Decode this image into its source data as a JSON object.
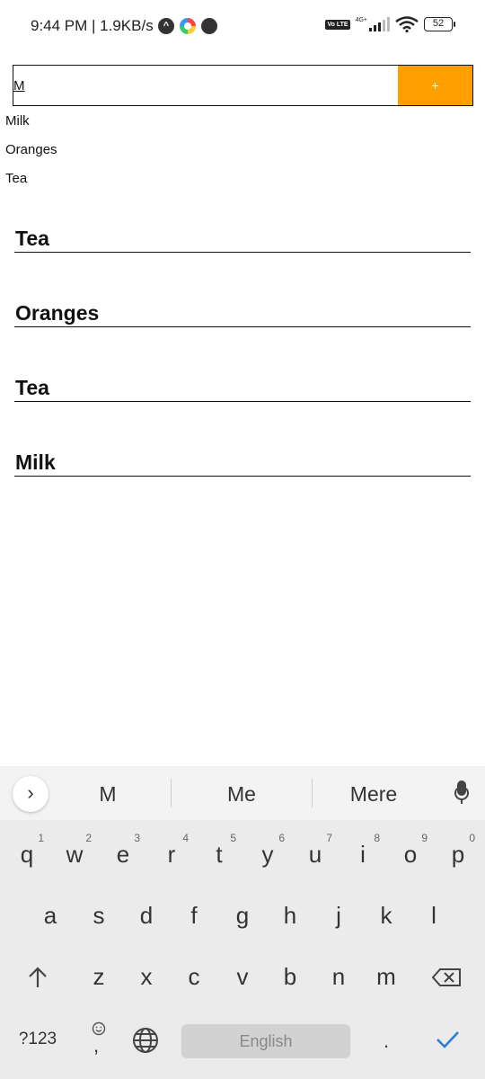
{
  "status_bar": {
    "time_speed": "9:44 PM | 1.9KB/s",
    "network": "4G+",
    "volte": "Vo LTE",
    "battery": "52"
  },
  "input": {
    "value": "M",
    "add_label": "+"
  },
  "suggestions": [
    "Milk",
    "Oranges",
    "Tea"
  ],
  "items": [
    "Tea",
    "Oranges",
    "Tea",
    "Milk"
  ],
  "keyboard": {
    "suggestions": [
      "M",
      "Me",
      "Mere"
    ],
    "row1": [
      {
        "key": "q",
        "hint": "1"
      },
      {
        "key": "w",
        "hint": "2"
      },
      {
        "key": "e",
        "hint": "3"
      },
      {
        "key": "r",
        "hint": "4"
      },
      {
        "key": "t",
        "hint": "5"
      },
      {
        "key": "y",
        "hint": "6"
      },
      {
        "key": "u",
        "hint": "7"
      },
      {
        "key": "i",
        "hint": "8"
      },
      {
        "key": "o",
        "hint": "9"
      },
      {
        "key": "p",
        "hint": "0"
      }
    ],
    "row2": [
      "a",
      "s",
      "d",
      "f",
      "g",
      "h",
      "j",
      "k",
      "l"
    ],
    "row3": [
      "z",
      "x",
      "c",
      "v",
      "b",
      "n",
      "m"
    ],
    "symbols_label": "?123",
    "comma": ",",
    "space_label": "English",
    "period": "."
  },
  "icons": {
    "expand": "chevron-right-icon",
    "mic": "microphone-icon",
    "shift": "shift-arrow-icon",
    "backspace": "backspace-icon",
    "emoji": "emoji-icon",
    "globe": "globe-icon",
    "enter": "checkmark-icon"
  },
  "colors": {
    "add_button": "#ffa000",
    "enter_key": "#2e7dd1"
  }
}
